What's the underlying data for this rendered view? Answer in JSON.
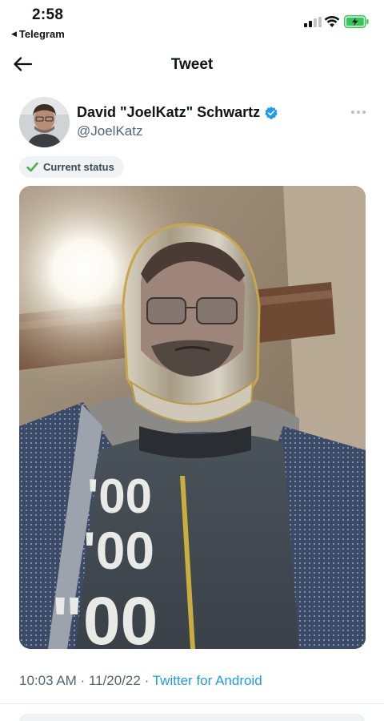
{
  "status_bar": {
    "time": "2:58",
    "back_app_label": "Telegram"
  },
  "nav": {
    "title": "Tweet"
  },
  "tweet": {
    "author": {
      "display_name": "David \"JoelKatz\" Schwartz",
      "handle": "@JoelKatz",
      "verified": true
    },
    "status_label": "Current status",
    "photo_alt": "photo",
    "shirt_text_lines": [
      "'00",
      "'00",
      "\"00"
    ],
    "timestamp": "10:03 AM · 11/20/22 · ",
    "source": "Twitter for Android"
  },
  "colors": {
    "link": "#1d9bf0",
    "verified": "#1d9bf0",
    "battery_fill": "#34c759",
    "secondary_text": "#536471",
    "status_check": "#4caf50"
  },
  "icons": {
    "back": "arrow-left-icon",
    "more": "more-horizontal-icon",
    "verified": "verified-badge-icon",
    "check": "check-icon",
    "signal": "signal-icon",
    "wifi": "wifi-icon",
    "battery": "battery-charging-icon"
  }
}
